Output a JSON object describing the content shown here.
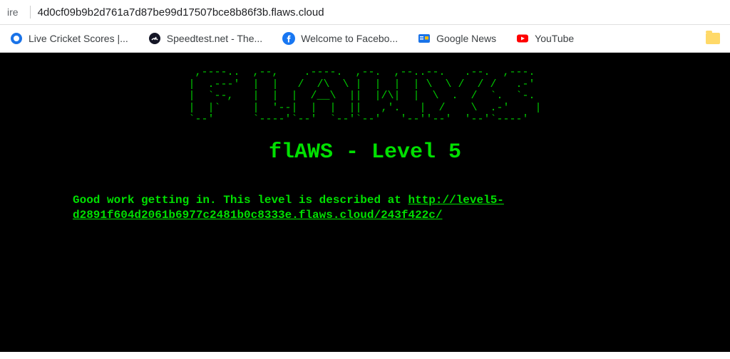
{
  "address_bar": {
    "secure_label": "ire",
    "url": "4d0cf09b9b2d761a7d87be99d17507bce8b86f3b.flaws.cloud"
  },
  "bookmarks": [
    {
      "label": "Live Cricket Scores |...",
      "icon": "cricket"
    },
    {
      "label": "Speedtest.net - The...",
      "icon": "speedtest"
    },
    {
      "label": "Welcome to Facebo...",
      "icon": "facebook"
    },
    {
      "label": "Google News",
      "icon": "googlenews"
    },
    {
      "label": "YouTube",
      "icon": "youtube"
    }
  ],
  "page": {
    "ascii_art": " ,----..  ,--,    .----.  ,--.  ,--..--.   .--.  ,---.\n|  .---'  |  |   /  /\\  \\ |  |  |  | \\  \\ /  / /   .-'\n|  `--,   |  |  |  /__\\  ||  |/\\|  |  \\  .  /  `.  `-.\n|  |`     |  '--|  |  |  ||   ,'.   |  /    \\  .-'    |\n`--'      `----'`--'  `--'`--'   '--''--'  '--'`----' ",
    "heading": "flAWS - Level 5",
    "description_prefix": "Good work getting in. This level is described at ",
    "description_link": "http://level5-d2891f604d2061b6977c2481b0c8333e.flaws.cloud/243f422c/"
  }
}
